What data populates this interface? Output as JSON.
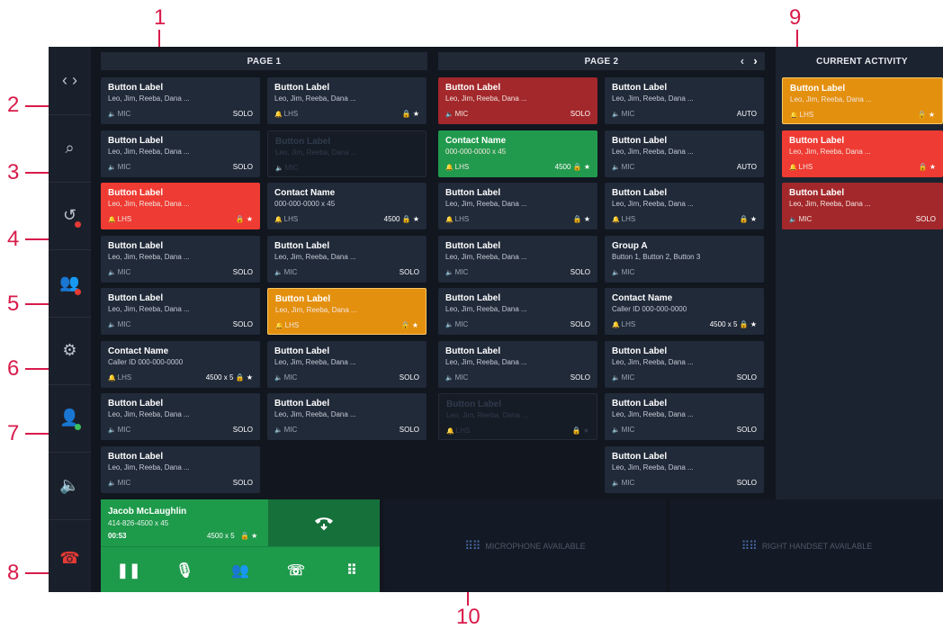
{
  "callouts": [
    "1",
    "2",
    "3",
    "4",
    "5",
    "6",
    "7",
    "8",
    "9",
    "10"
  ],
  "pages": {
    "page1_title": "PAGE 1",
    "page2_title": "PAGE 2",
    "prev_icon": "chevron-left-icon",
    "next_icon": "chevron-right-icon"
  },
  "activity": {
    "title": "CURRENT ACTIVITY"
  },
  "sidebar": [
    {
      "icon": "code-brackets-icon",
      "badge": ""
    },
    {
      "icon": "search-icon",
      "badge": ""
    },
    {
      "icon": "history-icon",
      "badge": "red"
    },
    {
      "icon": "group-icon",
      "badge": "red"
    },
    {
      "icon": "gear-icon",
      "badge": ""
    },
    {
      "icon": "user-status-icon",
      "badge": "green"
    },
    {
      "icon": "speaker-icon",
      "badge": ""
    },
    {
      "icon": "hangup-icon",
      "badge": ""
    }
  ],
  "tiles": {
    "col1": [
      {
        "title": "Button Label",
        "sub": "Leo, Jim, Reeba, Dana ...",
        "src": "MIC",
        "right": "SOLO",
        "style": ""
      },
      {
        "title": "Button Label",
        "sub": "Leo, Jim, Reeba, Dana ...",
        "src": "MIC",
        "right": "SOLO",
        "style": ""
      },
      {
        "title": "Button Label",
        "sub": "Leo, Jim, Reeba, Dana ...",
        "src": "LHS",
        "right": "🔒 ★",
        "style": "red"
      },
      {
        "title": "Button Label",
        "sub": "Leo, Jim, Reeba, Dana ...",
        "src": "MIC",
        "right": "SOLO",
        "style": ""
      },
      {
        "title": "Button Label",
        "sub": "Leo, Jim, Reeba, Dana ...",
        "src": "MIC",
        "right": "SOLO",
        "style": ""
      },
      {
        "title": "Contact Name",
        "sub": "Caller ID 000-000-0000",
        "src": "LHS",
        "right": "4500 x 5  🔒 ★",
        "style": ""
      },
      {
        "title": "Button Label",
        "sub": "Leo, Jim, Reeba, Dana ...",
        "src": "MIC",
        "right": "SOLO",
        "style": ""
      },
      {
        "title": "Button Label",
        "sub": "Leo, Jim, Reeba, Dana ...",
        "src": "MIC",
        "right": "SOLO",
        "style": ""
      }
    ],
    "col2": [
      {
        "title": "Button Label",
        "sub": "Leo, Jim, Reeba, Dana ...",
        "src": "LHS",
        "right": "🔒 ★",
        "style": ""
      },
      {
        "title": "Button Label",
        "sub": "Leo, Jim, Reeba, Dana ...",
        "src": "MIC",
        "right": "",
        "style": "disabled"
      },
      {
        "title": "Contact Name",
        "sub": "000-000-0000 x 45",
        "src": "LHS",
        "right": "4500  🔒 ★",
        "style": ""
      },
      {
        "title": "Button Label",
        "sub": "Leo, Jim, Reeba, Dana ...",
        "src": "MIC",
        "right": "SOLO",
        "style": ""
      },
      {
        "title": "Button Label",
        "sub": "Leo, Jim, Reeba, Dana ...",
        "src": "LHS",
        "right": "🔒 ★",
        "style": "orange"
      },
      {
        "title": "Button Label",
        "sub": "Leo, Jim, Reeba, Dana ...",
        "src": "MIC",
        "right": "SOLO",
        "style": ""
      },
      {
        "title": "Button Label",
        "sub": "Leo, Jim, Reeba, Dana ...",
        "src": "MIC",
        "right": "SOLO",
        "style": ""
      }
    ],
    "col3": [
      {
        "title": "Button Label",
        "sub": "Leo, Jim, Reeba, Dana ...",
        "src": "MIC",
        "right": "SOLO",
        "style": "darkred"
      },
      {
        "title": "Contact Name",
        "sub": "000-000-0000 x 45",
        "src": "LHS",
        "right": "4500  🔒 ★",
        "style": "green"
      },
      {
        "title": "Button Label",
        "sub": "Leo, Jim, Reeba, Dana ...",
        "src": "LHS",
        "right": "🔒 ★",
        "style": ""
      },
      {
        "title": "Button Label",
        "sub": "Leo, Jim, Reeba, Dana ...",
        "src": "MIC",
        "right": "SOLO",
        "style": ""
      },
      {
        "title": "Button Label",
        "sub": "Leo, Jim, Reeba, Dana ...",
        "src": "MIC",
        "right": "SOLO",
        "style": ""
      },
      {
        "title": "Button Label",
        "sub": "Leo, Jim, Reeba, Dana ...",
        "src": "MIC",
        "right": "SOLO",
        "style": ""
      },
      {
        "title": "Button Label",
        "sub": "Leo, Jim, Reeba, Dana ...",
        "src": "LHS",
        "right": "🔒 ★",
        "style": "disabled"
      }
    ],
    "col4": [
      {
        "title": "Button Label",
        "sub": "Leo, Jim, Reeba, Dana ...",
        "src": "MIC",
        "right": "AUTO",
        "style": ""
      },
      {
        "title": "Button Label",
        "sub": "Leo, Jim, Reeba, Dana ...",
        "src": "MIC",
        "right": "AUTO",
        "style": ""
      },
      {
        "title": "Button Label",
        "sub": "Leo, Jim, Reeba, Dana ...",
        "src": "LHS",
        "right": "🔒 ★",
        "style": ""
      },
      {
        "title": "Group A",
        "sub": "Button 1, Button 2, Button 3",
        "src": "MIC",
        "right": "",
        "style": ""
      },
      {
        "title": "Contact Name",
        "sub": "Caller ID 000-000-0000",
        "src": "LHS",
        "right": "4500 x 5  🔒 ★",
        "style": ""
      },
      {
        "title": "Button Label",
        "sub": "Leo, Jim, Reeba, Dana ...",
        "src": "MIC",
        "right": "SOLO",
        "style": ""
      },
      {
        "title": "Button Label",
        "sub": "Leo, Jim, Reeba, Dana ...",
        "src": "MIC",
        "right": "SOLO",
        "style": ""
      },
      {
        "title": "Button Label",
        "sub": "Leo, Jim, Reeba, Dana ...",
        "src": "MIC",
        "right": "SOLO",
        "style": ""
      }
    ],
    "activity": [
      {
        "title": "Button Label",
        "sub": "Leo, Jim, Reeba, Dana ...",
        "src": "LHS",
        "right": "🔒 ★",
        "style": "orange"
      },
      {
        "title": "Button Label",
        "sub": "Leo, Jim, Reeba, Dana ...",
        "src": "LHS",
        "right": "🔒 ★",
        "style": "red"
      },
      {
        "title": "Button Label",
        "sub": "Leo, Jim, Reeba, Dana ...",
        "src": "MIC",
        "right": "SOLO",
        "style": "darkred"
      },
      {
        "title": "",
        "sub": "",
        "src": "",
        "right": "",
        "style": "empty"
      },
      {
        "title": "",
        "sub": "",
        "src": "",
        "right": "",
        "style": "empty"
      },
      {
        "title": "",
        "sub": "",
        "src": "",
        "right": "",
        "style": "empty"
      },
      {
        "title": "",
        "sub": "",
        "src": "",
        "right": "",
        "style": "empty"
      },
      {
        "title": "",
        "sub": "",
        "src": "",
        "right": "",
        "style": "empty"
      }
    ]
  },
  "call": {
    "name": "Jacob McLaughlin",
    "number": "414-826-4500 x 45",
    "duration": "00:53",
    "extension": "4500 x 5",
    "flags": "🔒 ★",
    "controls": [
      {
        "icon": "pause-icon",
        "glyph": "❚❚"
      },
      {
        "icon": "microphone-icon",
        "glyph": "🎙"
      },
      {
        "icon": "conference-icon",
        "glyph": "👥"
      },
      {
        "icon": "transfer-call-icon",
        "glyph": "☏"
      },
      {
        "icon": "keypad-icon",
        "glyph": "⠿"
      }
    ]
  },
  "availability": {
    "microphone": "MICROPHONE AVAILABLE",
    "right_handset": "RIGHT HANDSET AVAILABLE"
  },
  "colors": {
    "red": "#ee3b33",
    "dark_red": "#a3282b",
    "green": "#229a4d",
    "orange": "#e4900f",
    "callout": "#d81b4a"
  }
}
